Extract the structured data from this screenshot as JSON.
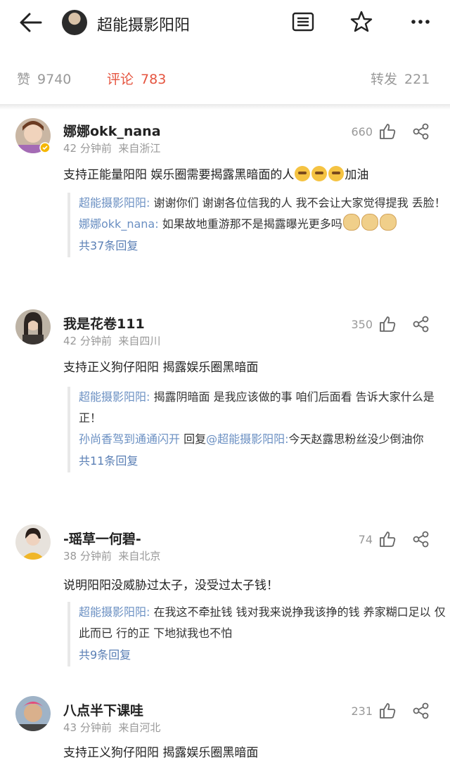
{
  "header": {
    "title": "超能摄影阳阳"
  },
  "tabs": {
    "likes_label": "赞",
    "likes_count": "9740",
    "comments_label": "评论",
    "comments_count": "783",
    "reposts_label": "转发",
    "reposts_count": "221"
  },
  "colors": {
    "accent": "#e5543f",
    "link": "#5a7fb5"
  },
  "icons": [
    "back-arrow-icon",
    "menu-list-icon",
    "star-icon",
    "more-icon",
    "like-icon",
    "share-icon"
  ],
  "comments": [
    {
      "name": "娜娜okk_nana",
      "time": "42 分钟前",
      "location": "来自浙江",
      "likes": "660",
      "text": "支持正能量阳阳 娱乐圈需要揭露黑暗面的人",
      "text_suffix": "加油",
      "replies": [
        {
          "user": "超能摄影阳阳",
          "sep": ":",
          "text": " 谢谢你们 谢谢各位信我的人 我不会让大家觉得提我 丢脸！"
        },
        {
          "user": "娜娜okk_nana",
          "sep": ":",
          "text": " 如果故地重游那不是揭露曝光更多吗"
        }
      ],
      "more": "共37条回复"
    },
    {
      "name": "我是花卷111",
      "time": "42 分钟前",
      "location": "来自四川",
      "likes": "350",
      "text": "支持正义狗仔阳阳 揭露娱乐圈黑暗面",
      "replies": [
        {
          "user": "超能摄影阳阳",
          "sep": ":",
          "text": " 揭露阴暗面 是我应该做的事 咱们后面看 告诉大家什么是正！"
        },
        {
          "user": "孙尚香驾到通通闪开",
          "mid": " 回复",
          "target": "@超能摄影阳阳",
          "sep": ":",
          "text": "今天赵露思粉丝没少倒油你"
        }
      ],
      "more": "共11条回复"
    },
    {
      "name": "-瑶草一何碧-",
      "time": "38 分钟前",
      "location": "来自北京",
      "likes": "74",
      "text": "说明阳阳没威胁过太子，没受过太子钱！",
      "replies": [
        {
          "user": "超能摄影阳阳",
          "sep": ":",
          "text": " 在我这不牵扯钱 钱对我来说挣我该挣的钱 养家糊口足以 仅此而已 行的正 下地狱我也不怕"
        }
      ],
      "more": "共9条回复"
    },
    {
      "name": "八点半下课哇",
      "time": "43 分钟前",
      "location": "来自河北",
      "likes": "231",
      "text": "支持正义狗仔阳阳 揭露娱乐圈黑暗面"
    }
  ]
}
